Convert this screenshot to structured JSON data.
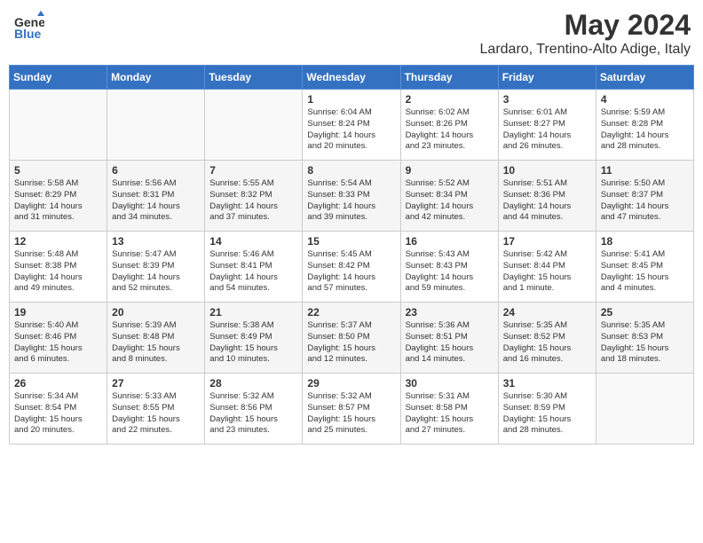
{
  "header": {
    "logo_line1": "General",
    "logo_line2": "Blue",
    "month": "May 2024",
    "location": "Lardaro, Trentino-Alto Adige, Italy"
  },
  "weekdays": [
    "Sunday",
    "Monday",
    "Tuesday",
    "Wednesday",
    "Thursday",
    "Friday",
    "Saturday"
  ],
  "weeks": [
    [
      {
        "day": "",
        "content": ""
      },
      {
        "day": "",
        "content": ""
      },
      {
        "day": "",
        "content": ""
      },
      {
        "day": "1",
        "content": "Sunrise: 6:04 AM\nSunset: 8:24 PM\nDaylight: 14 hours\nand 20 minutes."
      },
      {
        "day": "2",
        "content": "Sunrise: 6:02 AM\nSunset: 8:26 PM\nDaylight: 14 hours\nand 23 minutes."
      },
      {
        "day": "3",
        "content": "Sunrise: 6:01 AM\nSunset: 8:27 PM\nDaylight: 14 hours\nand 26 minutes."
      },
      {
        "day": "4",
        "content": "Sunrise: 5:59 AM\nSunset: 8:28 PM\nDaylight: 14 hours\nand 28 minutes."
      }
    ],
    [
      {
        "day": "5",
        "content": "Sunrise: 5:58 AM\nSunset: 8:29 PM\nDaylight: 14 hours\nand 31 minutes."
      },
      {
        "day": "6",
        "content": "Sunrise: 5:56 AM\nSunset: 8:31 PM\nDaylight: 14 hours\nand 34 minutes."
      },
      {
        "day": "7",
        "content": "Sunrise: 5:55 AM\nSunset: 8:32 PM\nDaylight: 14 hours\nand 37 minutes."
      },
      {
        "day": "8",
        "content": "Sunrise: 5:54 AM\nSunset: 8:33 PM\nDaylight: 14 hours\nand 39 minutes."
      },
      {
        "day": "9",
        "content": "Sunrise: 5:52 AM\nSunset: 8:34 PM\nDaylight: 14 hours\nand 42 minutes."
      },
      {
        "day": "10",
        "content": "Sunrise: 5:51 AM\nSunset: 8:36 PM\nDaylight: 14 hours\nand 44 minutes."
      },
      {
        "day": "11",
        "content": "Sunrise: 5:50 AM\nSunset: 8:37 PM\nDaylight: 14 hours\nand 47 minutes."
      }
    ],
    [
      {
        "day": "12",
        "content": "Sunrise: 5:48 AM\nSunset: 8:38 PM\nDaylight: 14 hours\nand 49 minutes."
      },
      {
        "day": "13",
        "content": "Sunrise: 5:47 AM\nSunset: 8:39 PM\nDaylight: 14 hours\nand 52 minutes."
      },
      {
        "day": "14",
        "content": "Sunrise: 5:46 AM\nSunset: 8:41 PM\nDaylight: 14 hours\nand 54 minutes."
      },
      {
        "day": "15",
        "content": "Sunrise: 5:45 AM\nSunset: 8:42 PM\nDaylight: 14 hours\nand 57 minutes."
      },
      {
        "day": "16",
        "content": "Sunrise: 5:43 AM\nSunset: 8:43 PM\nDaylight: 14 hours\nand 59 minutes."
      },
      {
        "day": "17",
        "content": "Sunrise: 5:42 AM\nSunset: 8:44 PM\nDaylight: 15 hours\nand 1 minute."
      },
      {
        "day": "18",
        "content": "Sunrise: 5:41 AM\nSunset: 8:45 PM\nDaylight: 15 hours\nand 4 minutes."
      }
    ],
    [
      {
        "day": "19",
        "content": "Sunrise: 5:40 AM\nSunset: 8:46 PM\nDaylight: 15 hours\nand 6 minutes."
      },
      {
        "day": "20",
        "content": "Sunrise: 5:39 AM\nSunset: 8:48 PM\nDaylight: 15 hours\nand 8 minutes."
      },
      {
        "day": "21",
        "content": "Sunrise: 5:38 AM\nSunset: 8:49 PM\nDaylight: 15 hours\nand 10 minutes."
      },
      {
        "day": "22",
        "content": "Sunrise: 5:37 AM\nSunset: 8:50 PM\nDaylight: 15 hours\nand 12 minutes."
      },
      {
        "day": "23",
        "content": "Sunrise: 5:36 AM\nSunset: 8:51 PM\nDaylight: 15 hours\nand 14 minutes."
      },
      {
        "day": "24",
        "content": "Sunrise: 5:35 AM\nSunset: 8:52 PM\nDaylight: 15 hours\nand 16 minutes."
      },
      {
        "day": "25",
        "content": "Sunrise: 5:35 AM\nSunset: 8:53 PM\nDaylight: 15 hours\nand 18 minutes."
      }
    ],
    [
      {
        "day": "26",
        "content": "Sunrise: 5:34 AM\nSunset: 8:54 PM\nDaylight: 15 hours\nand 20 minutes."
      },
      {
        "day": "27",
        "content": "Sunrise: 5:33 AM\nSunset: 8:55 PM\nDaylight: 15 hours\nand 22 minutes."
      },
      {
        "day": "28",
        "content": "Sunrise: 5:32 AM\nSunset: 8:56 PM\nDaylight: 15 hours\nand 23 minutes."
      },
      {
        "day": "29",
        "content": "Sunrise: 5:32 AM\nSunset: 8:57 PM\nDaylight: 15 hours\nand 25 minutes."
      },
      {
        "day": "30",
        "content": "Sunrise: 5:31 AM\nSunset: 8:58 PM\nDaylight: 15 hours\nand 27 minutes."
      },
      {
        "day": "31",
        "content": "Sunrise: 5:30 AM\nSunset: 8:59 PM\nDaylight: 15 hours\nand 28 minutes."
      },
      {
        "day": "",
        "content": ""
      }
    ]
  ]
}
